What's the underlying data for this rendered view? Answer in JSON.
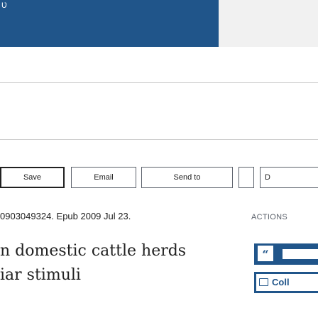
{
  "header": {
    "corner_glyph": "Ʋ"
  },
  "toolbar": {
    "buttons": [
      {
        "label": "Save"
      },
      {
        "label": "Email"
      },
      {
        "label": "Send to"
      },
      {
        "label": "D"
      }
    ]
  },
  "article": {
    "citation": "0903049324. Epub 2009 Jul 23.",
    "title_lines": [
      "n domestic cattle herds",
      "iar stimuli"
    ]
  },
  "actions": {
    "heading": "ACTIONS",
    "cite_glyph": "“",
    "collections_label": "Coll"
  },
  "colors": {
    "brand": "#20558a",
    "text": "#212121",
    "muted": "#5b616b"
  }
}
